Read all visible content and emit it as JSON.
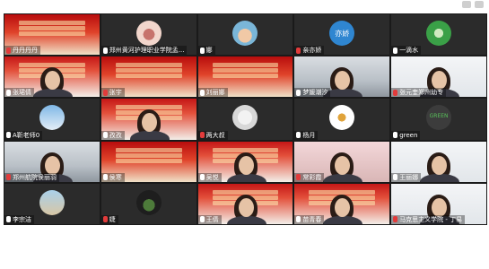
{
  "window": {
    "accent": "#b80d0d"
  },
  "tiles": [
    {
      "name": "丹丹丹丹",
      "type": "slide"
    },
    {
      "name": "郑州黄河护理职业学院孟...",
      "type": "avatar",
      "avatar": "lips"
    },
    {
      "name": "娜",
      "type": "avatar",
      "avatar": "child"
    },
    {
      "name": "亲亦娇",
      "type": "avatar",
      "avatar": "text",
      "avatar_text": "亦娇"
    },
    {
      "name": "一滴水",
      "type": "avatar",
      "avatar": "leaf"
    },
    {
      "name": "张珺倩",
      "type": "person_slide"
    },
    {
      "name": "张宇",
      "type": "slide"
    },
    {
      "name": "刘丽娜",
      "type": "slide"
    },
    {
      "name": "梦媛潮汐",
      "type": "person_room"
    },
    {
      "name": "张元奎郑州幼专",
      "type": "person_white"
    },
    {
      "name": "A靳老师0",
      "type": "avatar",
      "avatar": "sky"
    },
    {
      "name": "孜孜",
      "type": "person_slide"
    },
    {
      "name": "两大叔",
      "type": "avatar",
      "avatar": "photo"
    },
    {
      "name": "杨月",
      "type": "avatar",
      "avatar": "tulip"
    },
    {
      "name": "green",
      "type": "avatar",
      "avatar": "text-green",
      "avatar_text": "GREEN"
    },
    {
      "name": "郑州航院侯丽羽",
      "type": "person_room"
    },
    {
      "name": "侯寒",
      "type": "slide"
    },
    {
      "name": "吴悦",
      "type": "person_slide"
    },
    {
      "name": "常彩霞",
      "type": "person_pink"
    },
    {
      "name": "王丽娜",
      "type": "person_white"
    },
    {
      "name": "李宗洁",
      "type": "avatar",
      "avatar": "sea"
    },
    {
      "name": "婕",
      "type": "avatar",
      "avatar": "plant"
    },
    {
      "name": "王倩",
      "type": "person_slide"
    },
    {
      "name": "苗青春",
      "type": "person_slide"
    },
    {
      "name": "马克思主义学院 - 丁易",
      "type": "person_white"
    }
  ]
}
